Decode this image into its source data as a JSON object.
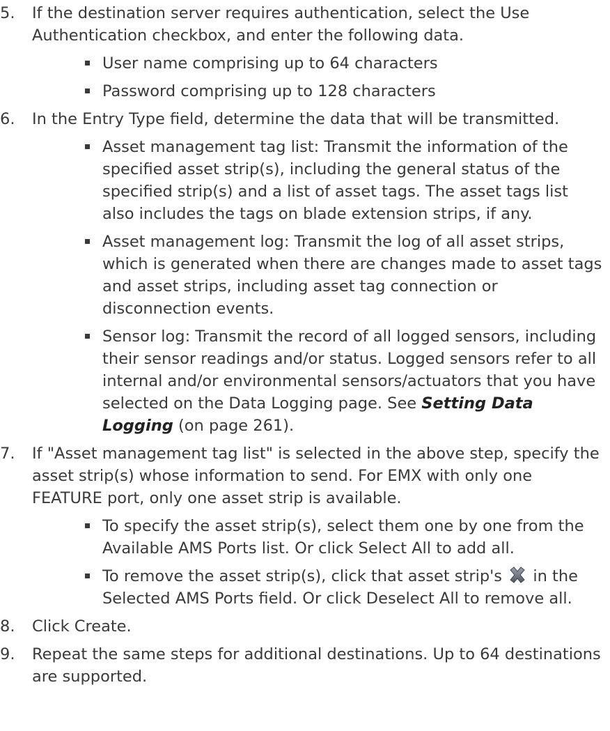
{
  "steps": [
    {
      "num": "5.",
      "text": "If the destination server requires authentication, select the Use Authentication checkbox, and enter the following data.",
      "bullets": [
        "User name comprising up to 64 characters",
        "Password comprising up to 128 characters"
      ]
    },
    {
      "num": "6.",
      "text": "In the Entry Type field, determine the data that will be transmitted.",
      "bullets": [
        "Asset management tag list: Transmit the information of the specified asset strip(s), including the general status of the specified strip(s) and a list of asset tags. The asset tags list also includes the tags on blade extension strips, if any.",
        "Asset management log: Transmit the log of all asset strips, which is generated when there are changes made to asset tags and asset strips, including asset tag connection or disconnection events."
      ],
      "sensor_bullet": {
        "before": "Sensor log: Transmit the record of all logged sensors, including their sensor readings and/or status. Logged sensors refer to all internal and/or environmental sensors/actuators that you have selected on the Data Logging page. See ",
        "link": "Setting Data Logging",
        "after": " (on page 261)."
      }
    },
    {
      "num": "7.",
      "text": "If \"Asset management tag list\" is selected in the above step, specify the asset strip(s) whose information to send. For EMX with only one FEATURE port, only one asset strip is available.",
      "bullets": [
        "To specify the asset strip(s), select them one by one from the Available AMS Ports list. Or click Select All to add all."
      ],
      "remove_bullet": {
        "before": "To remove the asset strip(s), click that asset strip's",
        "after": "in the Selected AMS Ports field. Or click Deselect All to remove all.",
        "icon": "remove-x-icon"
      }
    },
    {
      "num": "8.",
      "text": "Click Create."
    },
    {
      "num": "9.",
      "text": "Repeat the same steps for additional destinations. Up to 64 destinations are supported."
    }
  ]
}
